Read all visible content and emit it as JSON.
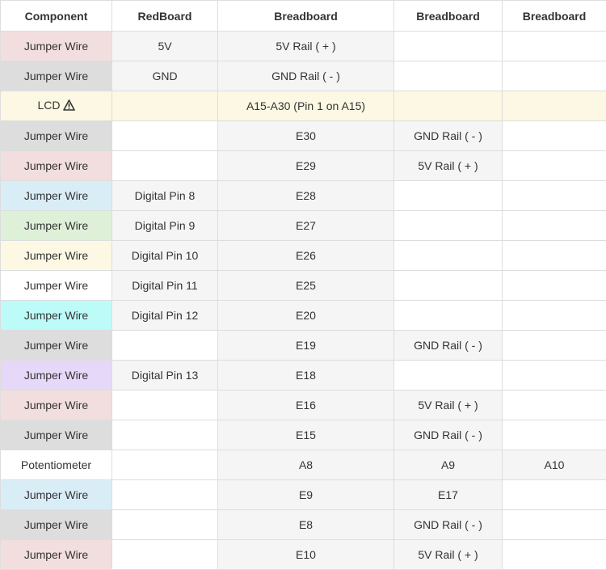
{
  "headers": [
    "Component",
    "RedBoard",
    "Breadboard",
    "Breadboard",
    "Breadboard"
  ],
  "colors": {
    "pink": "#f2dede",
    "gray": "#dddddd",
    "cream": "#fcf8e3",
    "blue": "#d9edf7",
    "green": "#dff0d8",
    "ivory": "#fcf8e3",
    "white": "#ffffff",
    "cyan": "#bcfbf8",
    "lavender": "#e6d8f8",
    "stripe": "#f5f5f5"
  },
  "rows": [
    {
      "component": "Jumper Wire",
      "cells": [
        "5V",
        "5V Rail ( + )",
        "",
        ""
      ],
      "color": "pink"
    },
    {
      "component": "Jumper Wire",
      "cells": [
        "GND",
        "GND Rail ( - )",
        "",
        ""
      ],
      "color": "gray"
    },
    {
      "component": "LCD",
      "cells": [
        "",
        "A15-A30 (Pin 1 on A15)",
        "",
        ""
      ],
      "color": "cream",
      "icon": "warning-icon"
    },
    {
      "component": "Jumper Wire",
      "cells": [
        "",
        "E30",
        "GND Rail ( - )",
        ""
      ],
      "color": "gray"
    },
    {
      "component": "Jumper Wire",
      "cells": [
        "",
        "E29",
        "5V Rail ( + )",
        ""
      ],
      "color": "pink"
    },
    {
      "component": "Jumper Wire",
      "cells": [
        "Digital Pin 8",
        "E28",
        "",
        ""
      ],
      "color": "blue"
    },
    {
      "component": "Jumper Wire",
      "cells": [
        "Digital Pin 9",
        "E27",
        "",
        ""
      ],
      "color": "green"
    },
    {
      "component": "Jumper Wire",
      "cells": [
        "Digital Pin 10",
        "E26",
        "",
        ""
      ],
      "color": "ivory"
    },
    {
      "component": "Jumper Wire",
      "cells": [
        "Digital Pin 11",
        "E25",
        "",
        ""
      ],
      "color": "white"
    },
    {
      "component": "Jumper Wire",
      "cells": [
        "Digital Pin 12",
        "E20",
        "",
        ""
      ],
      "color": "cyan"
    },
    {
      "component": "Jumper Wire",
      "cells": [
        "",
        "E19",
        "GND Rail ( - )",
        ""
      ],
      "color": "gray"
    },
    {
      "component": "Jumper Wire",
      "cells": [
        "Digital Pin 13",
        "E18",
        "",
        ""
      ],
      "color": "lavender"
    },
    {
      "component": "Jumper Wire",
      "cells": [
        "",
        "E16",
        "5V Rail ( + )",
        ""
      ],
      "color": "pink"
    },
    {
      "component": "Jumper Wire",
      "cells": [
        "",
        "E15",
        "GND Rail ( - )",
        ""
      ],
      "color": "gray"
    },
    {
      "component": "Potentiometer",
      "cells": [
        "",
        "A8",
        "A9",
        "A10"
      ],
      "color": "white"
    },
    {
      "component": "Jumper Wire",
      "cells": [
        "",
        "E9",
        "E17",
        ""
      ],
      "color": "blue"
    },
    {
      "component": "Jumper Wire",
      "cells": [
        "",
        "E8",
        "GND Rail ( - )",
        ""
      ],
      "color": "gray"
    },
    {
      "component": "Jumper Wire",
      "cells": [
        "",
        "E10",
        "5V Rail ( + )",
        ""
      ],
      "color": "pink"
    }
  ]
}
